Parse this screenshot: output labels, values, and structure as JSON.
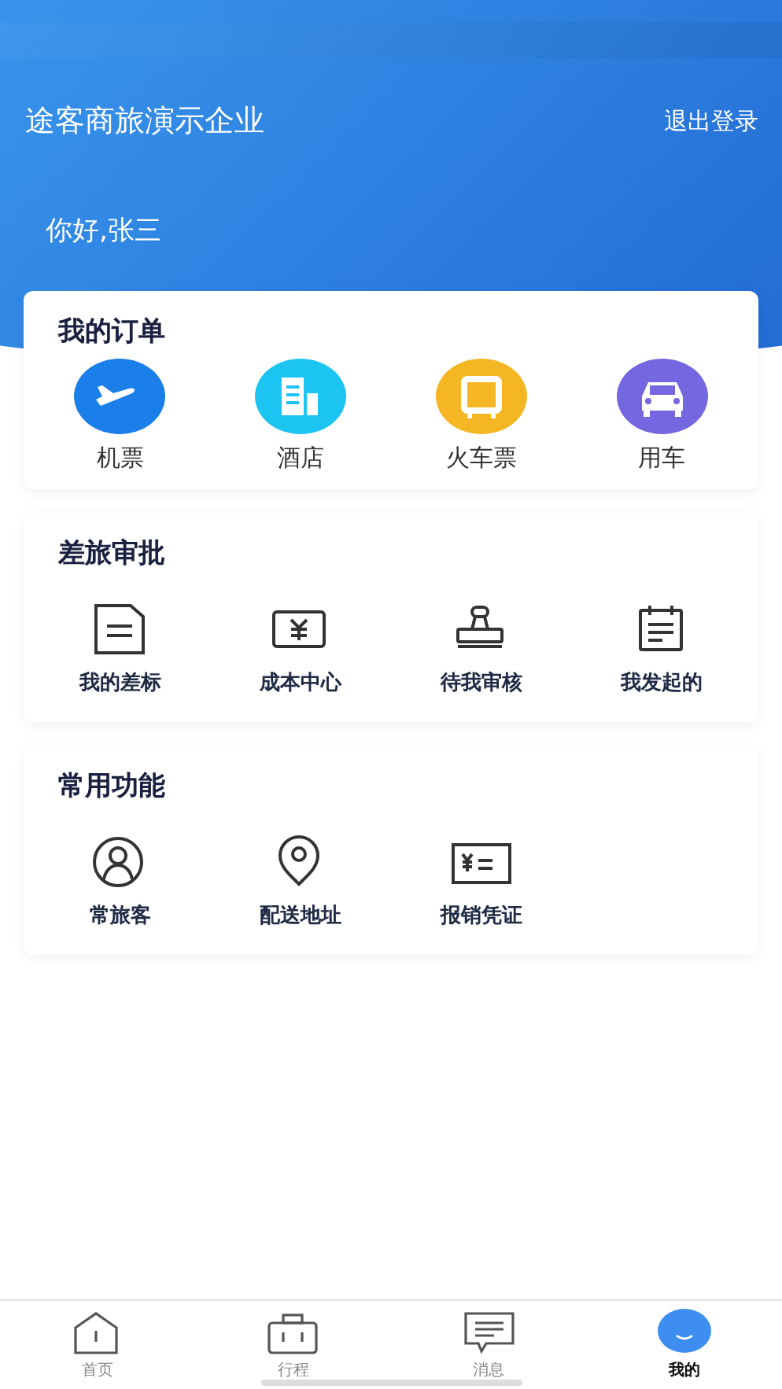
{
  "header": {
    "company": "途客商旅演示企业",
    "logout": "退出登录",
    "greeting": "你好,张三"
  },
  "orders": {
    "title": "我的订单",
    "items": [
      {
        "label": "机票",
        "kind": "flight",
        "color": "#1a7fe8"
      },
      {
        "label": "酒店",
        "kind": "hotel",
        "color": "#1cc4f2"
      },
      {
        "label": "火车票",
        "kind": "train",
        "color": "#f5b623"
      },
      {
        "label": "用车",
        "kind": "car",
        "color": "#7467e0"
      }
    ]
  },
  "approval": {
    "title": "差旅审批",
    "items": [
      {
        "label": "我的差标",
        "kind": "document"
      },
      {
        "label": "成本中心",
        "kind": "money"
      },
      {
        "label": "待我审核",
        "kind": "stamp"
      },
      {
        "label": "我发起的",
        "kind": "calendar"
      }
    ]
  },
  "functions": {
    "title": "常用功能",
    "items": [
      {
        "label": "常旅客",
        "kind": "person"
      },
      {
        "label": "配送地址",
        "kind": "pin"
      },
      {
        "label": "报销凭证",
        "kind": "voucher"
      }
    ]
  },
  "tabs": [
    {
      "label": "首页",
      "kind": "home",
      "selected": false
    },
    {
      "label": "行程",
      "kind": "bag",
      "selected": false
    },
    {
      "label": "消息",
      "kind": "message",
      "selected": false
    },
    {
      "label": "我的",
      "kind": "me",
      "selected": true
    }
  ]
}
